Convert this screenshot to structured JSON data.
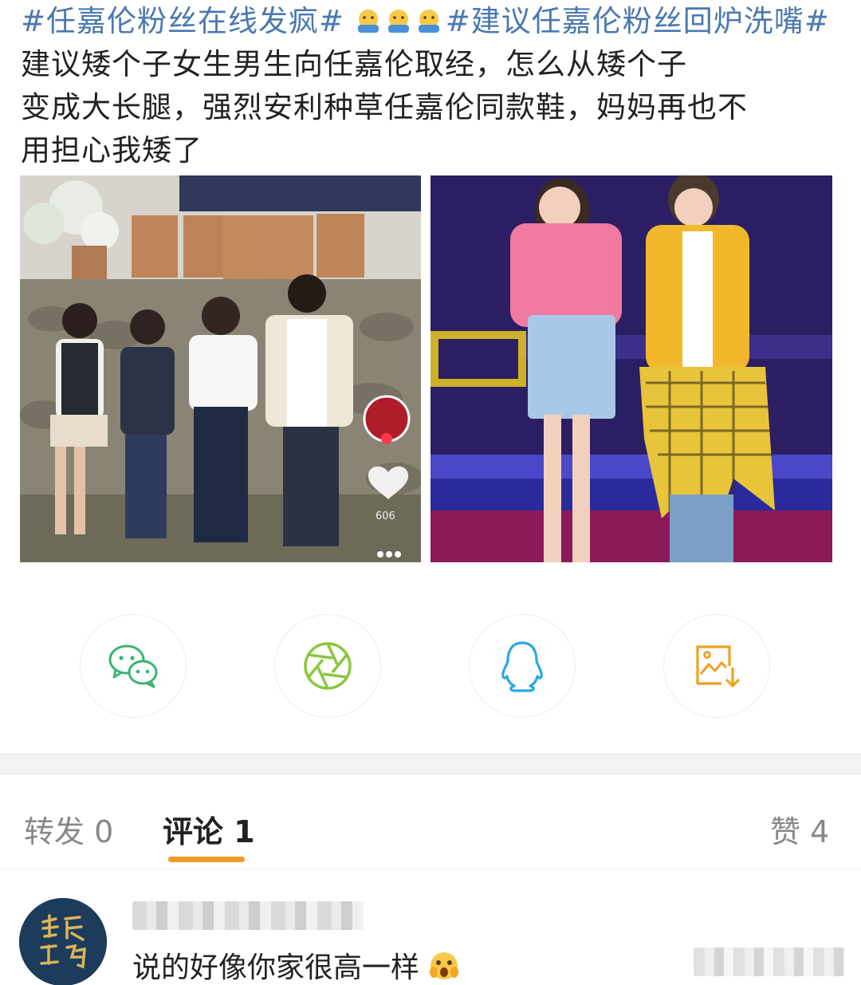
{
  "post": {
    "hashtag1": "#任嘉伦粉丝在线发疯#",
    "hashtag2": "#建议任嘉伦粉丝回炉洗嘴#",
    "line2_text": "建议矮个子女生男生向任嘉伦取经，怎么从矮个子",
    "line3_text": "变成大长腿，强烈安利种草任嘉伦同款鞋，妈妈再也不",
    "line4_text": "用担心我矮了",
    "emoji": "shrug-face-emoji"
  },
  "photos": [
    {
      "name": "group-photo-garden",
      "overlay_count": "606"
    },
    {
      "name": "stage-duet-photo"
    }
  ],
  "share": {
    "wechat": {
      "icon": "wechat-icon",
      "color": "#3cb371"
    },
    "moments": {
      "icon": "moments-aperture-icon",
      "color": "#8cc63f"
    },
    "qq": {
      "icon": "qq-penguin-icon",
      "color": "#2aa8e0"
    },
    "save_image": {
      "icon": "save-image-icon",
      "color": "#f0a020"
    }
  },
  "tabs": {
    "repost": "转发 0",
    "comment": "评论 1",
    "like": "赞 4",
    "active_color": "#f49a24"
  },
  "comment": {
    "avatar_icon": "avatar-calligraphy-logo",
    "text": "说的好像你家很高一样",
    "emoji": "surprised-face-emoji"
  }
}
